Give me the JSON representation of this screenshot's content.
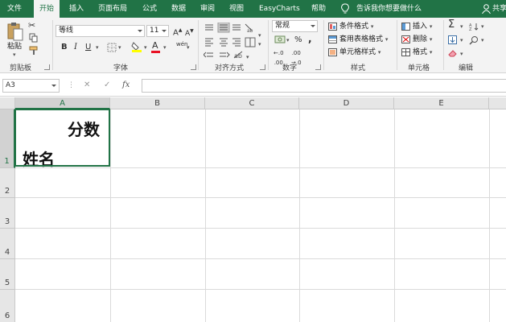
{
  "menu": {
    "tabs": [
      "文件",
      "开始",
      "插入",
      "页面布局",
      "公式",
      "数据",
      "审阅",
      "视图",
      "EasyCharts",
      "帮助"
    ],
    "tell_me": "告诉我你想要做什么",
    "share": "共享"
  },
  "ribbon": {
    "clipboard": {
      "paste": "粘贴",
      "label": "剪贴板"
    },
    "font": {
      "name": "等线",
      "size": "11",
      "bold": "B",
      "italic": "I",
      "underline": "U",
      "font_color_glyph": "A",
      "wen": "wén",
      "grow": "A",
      "shrink": "A",
      "label": "字体"
    },
    "alignment": {
      "label": "对齐方式"
    },
    "number": {
      "format": "常规",
      "percent": "%",
      "comma": ",",
      "label": "数字"
    },
    "styles": {
      "conditional": "条件格式",
      "as_table": "套用表格格式",
      "cell_styles": "单元格样式",
      "label": "样式"
    },
    "cells": {
      "insert": "插入",
      "delete": "删除",
      "format": "格式",
      "label": "单元格"
    },
    "editing": {
      "label": "编辑"
    }
  },
  "formula_bar": {
    "name_box": "A3",
    "cancel": "✕",
    "enter": "✓",
    "fx": "fx",
    "value": ""
  },
  "sheet": {
    "columns": [
      "A",
      "B",
      "C",
      "D",
      "E"
    ],
    "rows": [
      "1",
      "2",
      "3",
      "4",
      "5",
      "6"
    ],
    "cell_a1_top": "分数",
    "cell_a1_bottom": "姓名"
  },
  "colors": {
    "accent": "#217346",
    "ribbon_bg": "#f3f3f3",
    "font_red": "#e81123",
    "fill_yellow": "#ffff00"
  }
}
